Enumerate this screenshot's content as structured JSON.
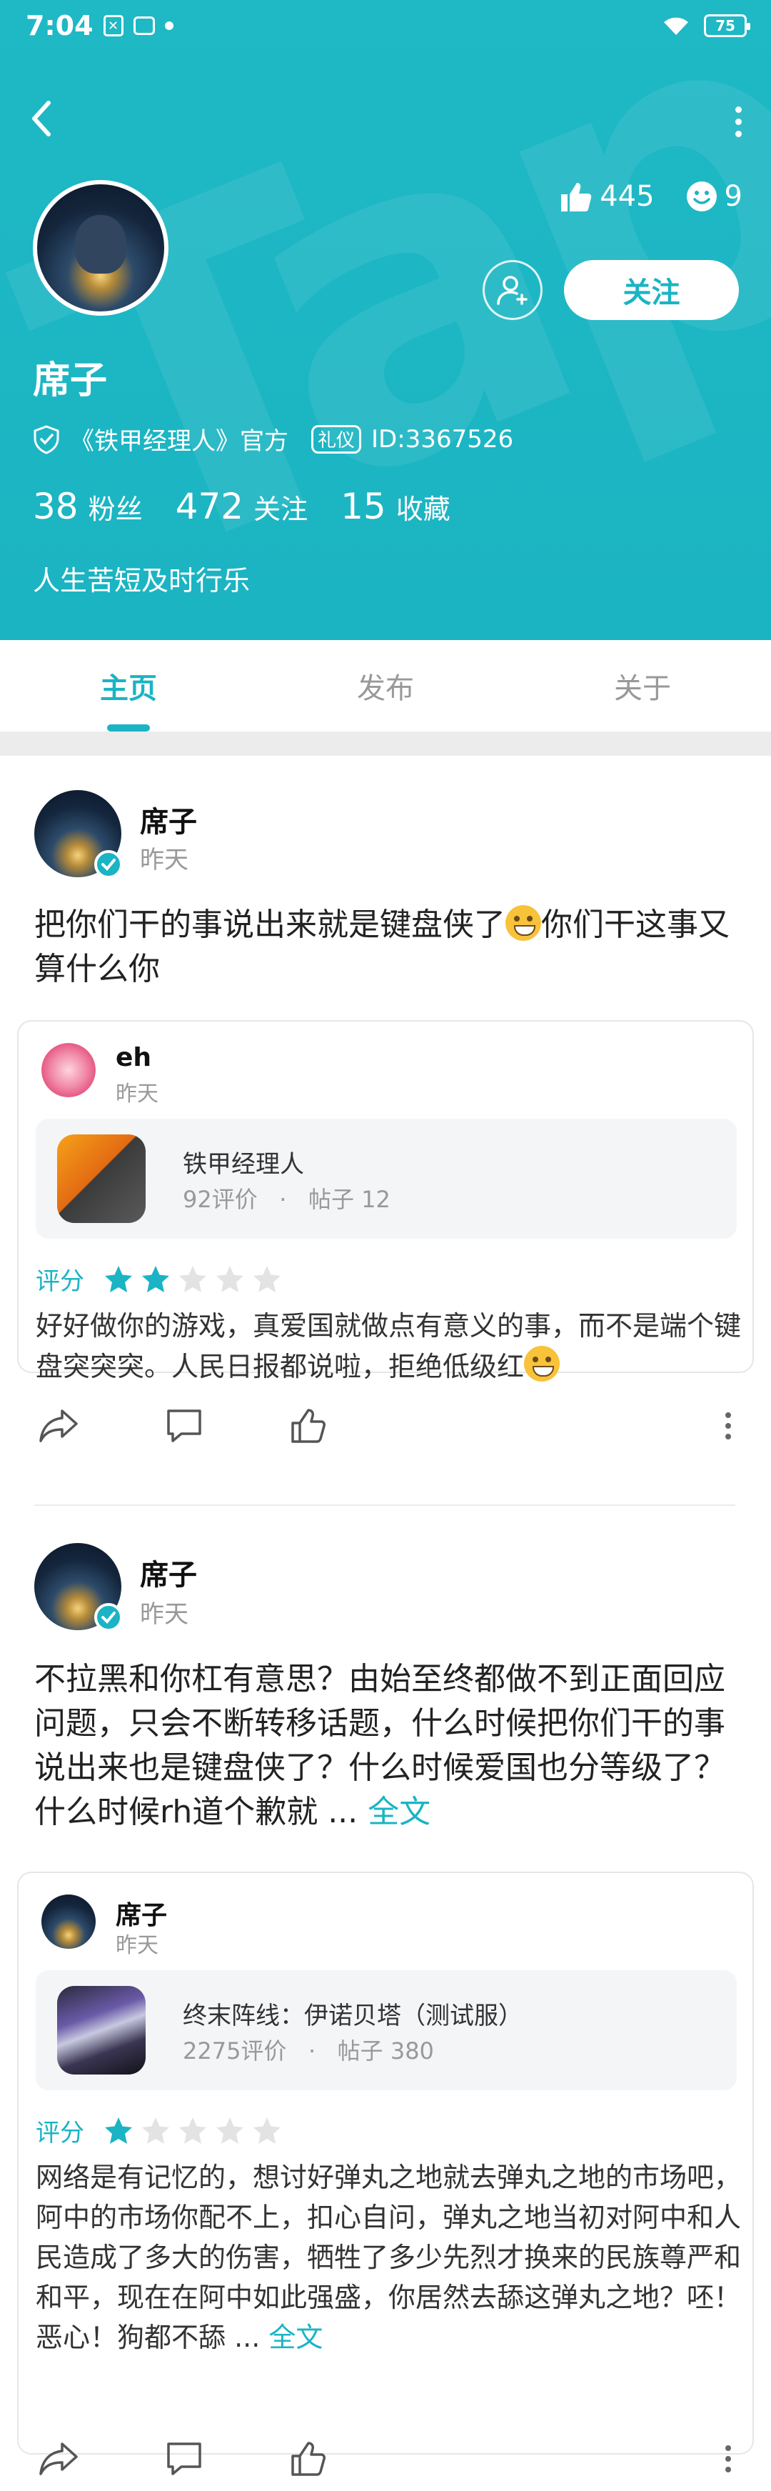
{
  "status_bar": {
    "time": "7:04",
    "battery": "75"
  },
  "profile": {
    "name": "席子",
    "likes": "445",
    "smiles": "9",
    "follow_label": "关注",
    "verified_text": "《铁甲经理人》官方",
    "gift_label": "礼仪",
    "id_text": "ID:3367526",
    "fans_count": "38",
    "fans_label": "粉丝",
    "following_count": "472",
    "following_label": "关注",
    "fav_count": "15",
    "fav_label": "收藏",
    "bio": "人生苦短及时行乐"
  },
  "tabs": [
    {
      "label": "主页"
    },
    {
      "label": "发布"
    },
    {
      "label": "关于"
    }
  ],
  "posts": [
    {
      "author": "席子",
      "time": "昨天",
      "text": "把你们干的事说出来就是键盘侠了",
      "text_after_emoji": "你们干这事又算什么你",
      "quoted": {
        "author": "eh",
        "time": "昨天",
        "game_name": "铁甲经理人",
        "game_reviews": "92评价",
        "game_posts": "帖子 12",
        "rating_label": "评分",
        "stars": 2,
        "text": "好好做你的游戏，真爱国就做点有意义的事，而不是端个键盘突突突。人民日报都说啦，拒绝低级红"
      }
    },
    {
      "author": "席子",
      "time": "昨天",
      "text": "不拉黑和你杠有意思？由始至终都做不到正面回应问题，只会不断转移话题，什么时候把你们干的事说出来也是键盘侠了？什么时候爱国也分等级了？什么时候rh道个歉就 ...",
      "full_label": "全文",
      "quoted": {
        "author": "席子",
        "time": "昨天",
        "game_name": "终末阵线：伊诺贝塔（测试服）",
        "game_reviews": "2275评价",
        "game_posts": "帖子 380",
        "rating_label": "评分",
        "stars": 1,
        "text": "网络是有记忆的，想讨好弹丸之地就去弹丸之地的市场吧，阿中的市场你配不上，扣心自问，弹丸之地当初对阿中和人民造成了多大的伤害，牺牲了多少先烈才换来的民族尊严和和平，现在在阿中如此强盛，你居然去舔这弹丸之地？呸！恶心！狗都不舔 ...",
        "full_label": "全文"
      }
    }
  ]
}
